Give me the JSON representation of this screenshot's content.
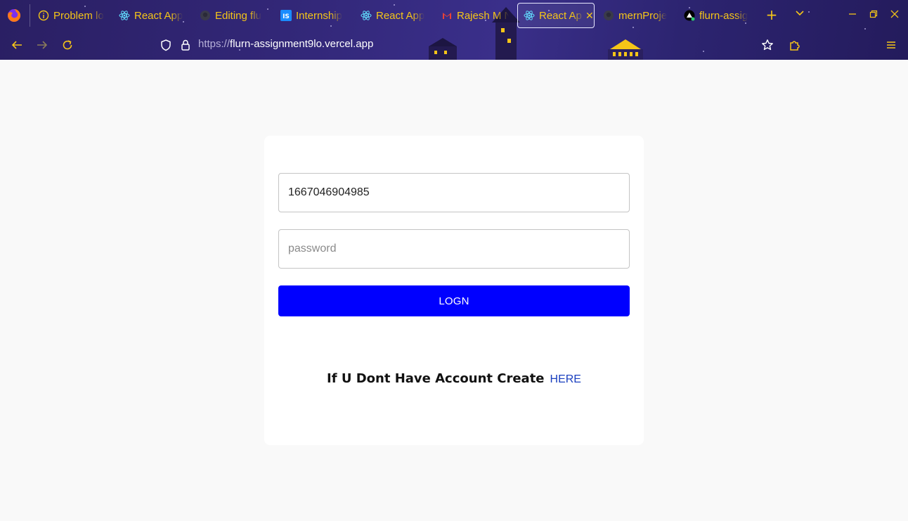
{
  "browser": {
    "tabs": [
      {
        "label": "Problem lo",
        "icon": "info-icon"
      },
      {
        "label": "React App",
        "icon": "react-icon"
      },
      {
        "label": "Editing flu",
        "icon": "github-icon"
      },
      {
        "label": "Internship",
        "icon": "internshala-icon"
      },
      {
        "label": "React App",
        "icon": "react-icon"
      },
      {
        "label": "Rajesh M N",
        "icon": "gmail-icon"
      },
      {
        "label": "React Ap",
        "icon": "react-icon",
        "active": true
      },
      {
        "label": "mernProje",
        "icon": "github-icon"
      },
      {
        "label": "flurn-assig",
        "icon": "vercel-icon"
      }
    ],
    "new_tab": "+",
    "list_all_tabs": "⌄",
    "url_scheme": "https://",
    "url_host": "flurn-assignment9lo.vercel.app",
    "accent_color": "#f5c518"
  },
  "login": {
    "username_value": "1667046904985",
    "password_placeholder": "password",
    "login_label": "LOGN",
    "signup_prompt": "If U Dont Have Account Create",
    "signup_link": "HERE",
    "button_color": "#0000ff"
  }
}
